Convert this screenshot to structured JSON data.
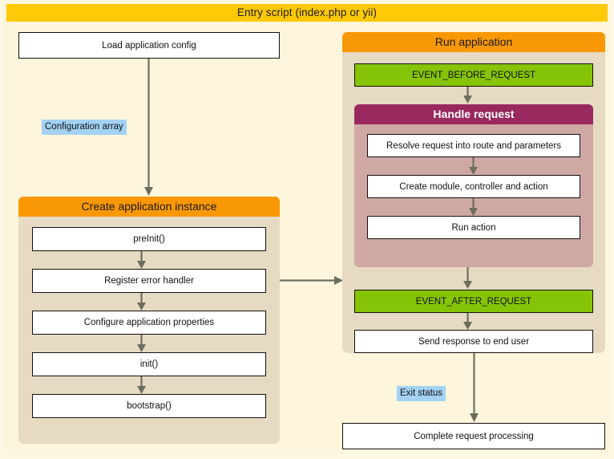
{
  "diagram": {
    "type": "flowchart",
    "title": "Entry script (index.php or yii)",
    "colors": {
      "page_background": "#FDF8E3",
      "panel_background": "#FDF6DC",
      "entry_title_bar": "#FFC907",
      "group_background": "#E6DAC2",
      "group_title_orange": "#F99806",
      "handle_request_background": "#CFA8A4",
      "handle_request_title": "#99285F",
      "event_box": "#86C408",
      "process_box": "#FFFFFF",
      "data_label": "#A3D2F4",
      "arrow": "#6E6E5E",
      "border": "#111111"
    }
  },
  "left_column": {
    "load_config": "Load application config",
    "data_label": "Configuration array",
    "create_app": {
      "title": "Create application instance",
      "steps": [
        "preInit()",
        "Register error handler",
        "Configure application properties",
        "init()",
        "bootstrap()"
      ]
    }
  },
  "right_column": {
    "run_app": {
      "title": "Run application",
      "event_before": "EVENT_BEFORE_REQUEST",
      "handle_request": {
        "title": "Handle request",
        "steps": [
          "Resolve request into route and parameters",
          "Create module, controller and action",
          "Run action"
        ]
      },
      "event_after": "EVENT_AFTER_REQUEST",
      "send_response": "Send response to end user"
    },
    "data_label": "Exit status",
    "complete": "Complete request processing"
  }
}
